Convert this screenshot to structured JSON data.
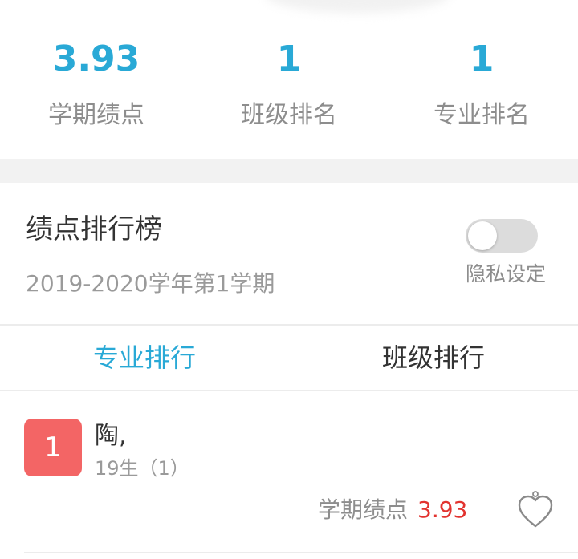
{
  "stats": [
    {
      "value": "3.93",
      "label": "学期绩点"
    },
    {
      "value": "1",
      "label": "班级排名"
    },
    {
      "value": "1",
      "label": "专业排名"
    }
  ],
  "ranking": {
    "title": "绩点排行榜",
    "term": "2019-2020学年第1学期",
    "privacy_label": "隐私设定",
    "privacy_enabled": false
  },
  "tabs": [
    {
      "label": "专业排行",
      "active": true
    },
    {
      "label": "班级排行",
      "active": false
    }
  ],
  "entries": [
    {
      "rank": "1",
      "name": "陶,",
      "class": "19生（1）",
      "gpa_label": "学期绩点",
      "gpa": "3.93",
      "icon": "heart-outline-icon"
    }
  ],
  "colors": {
    "accent": "#29a9d6",
    "badge": "#f36565",
    "gpa_value": "#e2332f"
  }
}
